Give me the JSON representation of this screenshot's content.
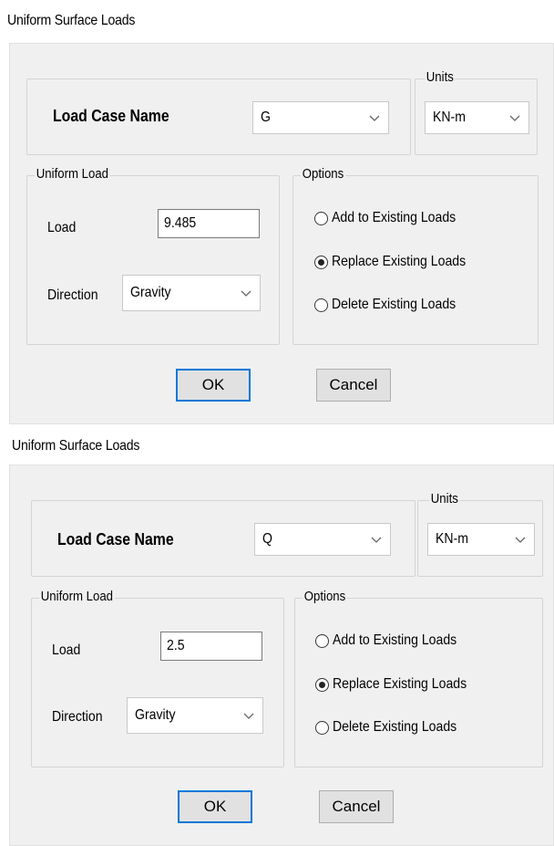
{
  "dialogs": [
    {
      "title": "Uniform Surface Loads",
      "load_case_label": "Load Case Name",
      "load_case_value": "G",
      "units_legend": "Units",
      "units_value": "KN-m",
      "uniform_load_legend": "Uniform Load",
      "load_label": "Load",
      "load_value": "9.485",
      "direction_label": "Direction",
      "direction_value": "Gravity",
      "options_legend": "Options",
      "options": [
        {
          "label": "Add to Existing Loads",
          "checked": false
        },
        {
          "label": "Replace Existing Loads",
          "checked": true
        },
        {
          "label": "Delete Existing Loads",
          "checked": false
        }
      ],
      "ok_label": "OK",
      "cancel_label": "Cancel"
    },
    {
      "title": "Uniform Surface Loads",
      "load_case_label": "Load Case Name",
      "load_case_value": "Q",
      "units_legend": "Units",
      "units_value": "KN-m",
      "uniform_load_legend": "Uniform Load",
      "load_label": "Load",
      "load_value": "2.5",
      "direction_label": "Direction",
      "direction_value": "Gravity",
      "options_legend": "Options",
      "options": [
        {
          "label": "Add to Existing Loads",
          "checked": false
        },
        {
          "label": "Replace Existing Loads",
          "checked": true
        },
        {
          "label": "Delete Existing Loads",
          "checked": false
        }
      ],
      "ok_label": "OK",
      "cancel_label": "Cancel"
    }
  ]
}
